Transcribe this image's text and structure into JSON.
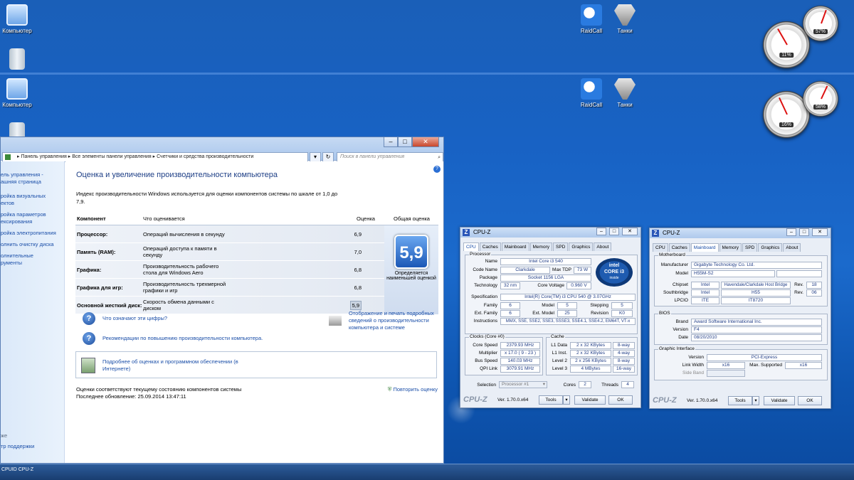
{
  "desktop": {
    "icons_top": [
      {
        "label": "Компьютер",
        "icon": "computer-icon"
      },
      {
        "label": "RaidCall",
        "icon": "raidcall-icon"
      },
      {
        "label": "Танки",
        "icon": "tanks-icon"
      }
    ],
    "icons_mid": [
      {
        "label": "Компьютер",
        "icon": "computer-icon"
      },
      {
        "label": "RaidCall",
        "icon": "raidcall-icon"
      },
      {
        "label": "Танки",
        "icon": "tanks-icon"
      }
    ],
    "gauges_top": {
      "cpu": "11%",
      "ram": "57%"
    },
    "gauges_mid": {
      "cpu": "16%",
      "ram": "58%"
    },
    "bottom_label": "CPUID CPU-Z"
  },
  "control_panel": {
    "address": [
      "Панель управления",
      "Все элементы панели управления",
      "Счетчики и средства производительности"
    ],
    "search_placeholder": "Поиск в панели управления",
    "sidebar": {
      "home": "ель управления -\nашняя страница",
      "links": [
        "ройка визуальных\nектов",
        "ройка параметров\nексирования",
        "ройка электропитания",
        "олнить очистку диска",
        "олнительные\nрументы"
      ],
      "see_also": "же",
      "support": "тр поддержки"
    },
    "title": "Оценка и увеличение производительности компьютера",
    "intro": "Индекс производительности Windows используется для оценки компонентов системы по шкале от 1,0 до 7,9.",
    "columns": {
      "component": "Компонент",
      "rated": "Что оценивается",
      "score": "Оценка",
      "overall": "Общая оценка"
    },
    "rows": [
      {
        "component": "Процессор:",
        "rated": "Операций вычисления в секунду",
        "score": "6,9"
      },
      {
        "component": "Память (RAM):",
        "rated": "Операций доступа к памяти в секунду",
        "score": "7,0"
      },
      {
        "component": "Графика:",
        "rated": "Производительность рабочего стола для Windows Aero",
        "score": "6,8"
      },
      {
        "component": "Графика для игр:",
        "rated": "Производительность трехмерной графики и игр",
        "score": "6,8"
      },
      {
        "component": "Основной жесткий диск:",
        "rated": "Скорость обмена данными с диском",
        "score": "5,9"
      }
    ],
    "overall_score": "5,9",
    "overall_caption": "Определяется наименьшей оценкой",
    "link_numbers": "Что означают эти цифры?",
    "link_print": "Отображение и печать подробных сведений о производительности компьютера и системе",
    "link_tips": "Рекомендации по повышению производительности компьютера.",
    "link_more": "Подробнее об оценках и программном обеспечении (в Интернете)",
    "status": "Оценки соответствуют текущему состоянию компонентов системы",
    "last_update": "Последнее обновление: 25.09.2014 13:47:11",
    "rerun": "Повторить оценку"
  },
  "cpuz_cpu": {
    "title": "CPU-Z",
    "tabs": [
      "CPU",
      "Caches",
      "Mainboard",
      "Memory",
      "SPD",
      "Graphics",
      "About"
    ],
    "active_tab": "CPU",
    "processor": {
      "group": "Processor",
      "name_label": "Name",
      "name": "Intel Core i3 540",
      "code_label": "Code Name",
      "code": "Clarkdale",
      "tdp_label": "Max TDP",
      "tdp": "73 W",
      "package_label": "Package",
      "package": "Socket 1156 LGA",
      "tech_label": "Technology",
      "tech": "32 nm",
      "voltage_label": "Core Voltage",
      "voltage": "0.960 V",
      "spec_label": "Specification",
      "spec": "Intel(R) Core(TM) i3 CPU      540 @ 3.07GHz",
      "family_label": "Family",
      "family": "6",
      "model_label": "Model",
      "model": "5",
      "stepping_label": "Stepping",
      "stepping": "5",
      "extfam_label": "Ext. Family",
      "extfam": "6",
      "extmod_label": "Ext. Model",
      "extmod": "25",
      "rev_label": "Revision",
      "rev": "K0",
      "instr_label": "Instructions",
      "instr": "MMX, SSE, SSE2, SSE3, SSSE3, SSE4.1, SSE4.2, EM64T, VT-x",
      "logo_line1": "intel",
      "logo_line2": "CORE",
      "logo_line3": "i3",
      "logo_line4": "inside"
    },
    "clocks": {
      "group": "Clocks (Core #0)",
      "speed_label": "Core Speed",
      "speed": "2379.93 MHz",
      "mult_label": "Multiplier",
      "mult": "x 17.0 ( 9 - 23 )",
      "bus_label": "Bus Speed",
      "bus": "140.03 MHz",
      "qpi_label": "QPI Link",
      "qpi": "3079.91 MHz"
    },
    "cache": {
      "group": "Cache",
      "l1d_label": "L1 Data",
      "l1d": "2 x 32 KBytes",
      "l1d_way": "8-way",
      "l1i_label": "L1 Inst.",
      "l1i": "2 x 32 KBytes",
      "l1i_way": "4-way",
      "l2_label": "Level 2",
      "l2": "2 x 256 KBytes",
      "l2_way": "8-way",
      "l3_label": "Level 3",
      "l3": "4 MBytes",
      "l3_way": "16-way"
    },
    "selection_label": "Selection",
    "selection": "Processor #1",
    "cores_label": "Cores",
    "cores": "2",
    "threads_label": "Threads",
    "threads": "4",
    "version": "Ver. 1.70.0.x64",
    "tools": "Tools",
    "validate": "Validate",
    "ok": "OK",
    "logo": "CPU-Z"
  },
  "cpuz_mb": {
    "title": "CPU-Z",
    "tabs": [
      "CPU",
      "Caches",
      "Mainboard",
      "Memory",
      "SPD",
      "Graphics",
      "About"
    ],
    "active_tab": "Mainboard",
    "motherboard": {
      "group": "Motherboard",
      "manu_label": "Manufacturer",
      "manu": "Gigabyte Technology Co. Ltd.",
      "model_label": "Model",
      "model": "H55M-S2",
      "chipset_label": "Chipset",
      "chipset_v": "Intel",
      "chipset": "Havendale/Clarkdale Host Bridge",
      "chipset_rev_label": "Rev.",
      "chipset_rev": "18",
      "south_label": "Southbridge",
      "south_v": "Intel",
      "south": "H55",
      "south_rev_label": "Rev.",
      "south_rev": "06",
      "lpcio_label": "LPCIO",
      "lpcio_v": "ITE",
      "lpcio": "IT8720"
    },
    "bios": {
      "group": "BIOS",
      "brand_label": "Brand",
      "brand": "Award Software International Inc.",
      "version_label": "Version",
      "version": "F4",
      "date_label": "Date",
      "date": "08/20/2010"
    },
    "graphic": {
      "group": "Graphic Interface",
      "ver_label": "Version",
      "ver": "PCI-Express",
      "lw_label": "Link Width",
      "lw": "x16",
      "ms_label": "Max. Supported",
      "ms": "x16",
      "sb_label": "Side Band"
    },
    "version": "Ver. 1.70.0.x64",
    "tools": "Tools",
    "validate": "Validate",
    "ok": "OK",
    "logo": "CPU-Z"
  }
}
